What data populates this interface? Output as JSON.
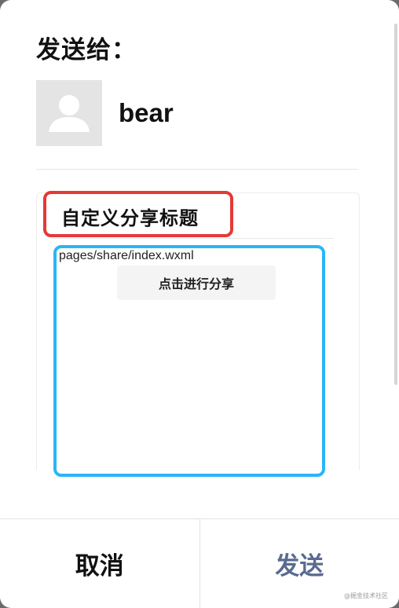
{
  "dialog": {
    "send_to_label": "发送给：",
    "recipient_name": "bear",
    "avatar_icon": "user-placeholder-icon"
  },
  "share_card": {
    "title": "自定义分享标题",
    "page_path": "pages/share/index.wxml",
    "share_button_label": "点击进行分享"
  },
  "annotations": {
    "title_box_color": "#e53935",
    "content_box_color": "#29b6f6"
  },
  "footer": {
    "cancel_label": "取消",
    "send_label": "发送",
    "send_color": "#5a6b8f"
  },
  "watermark": "@掘金技术社区"
}
